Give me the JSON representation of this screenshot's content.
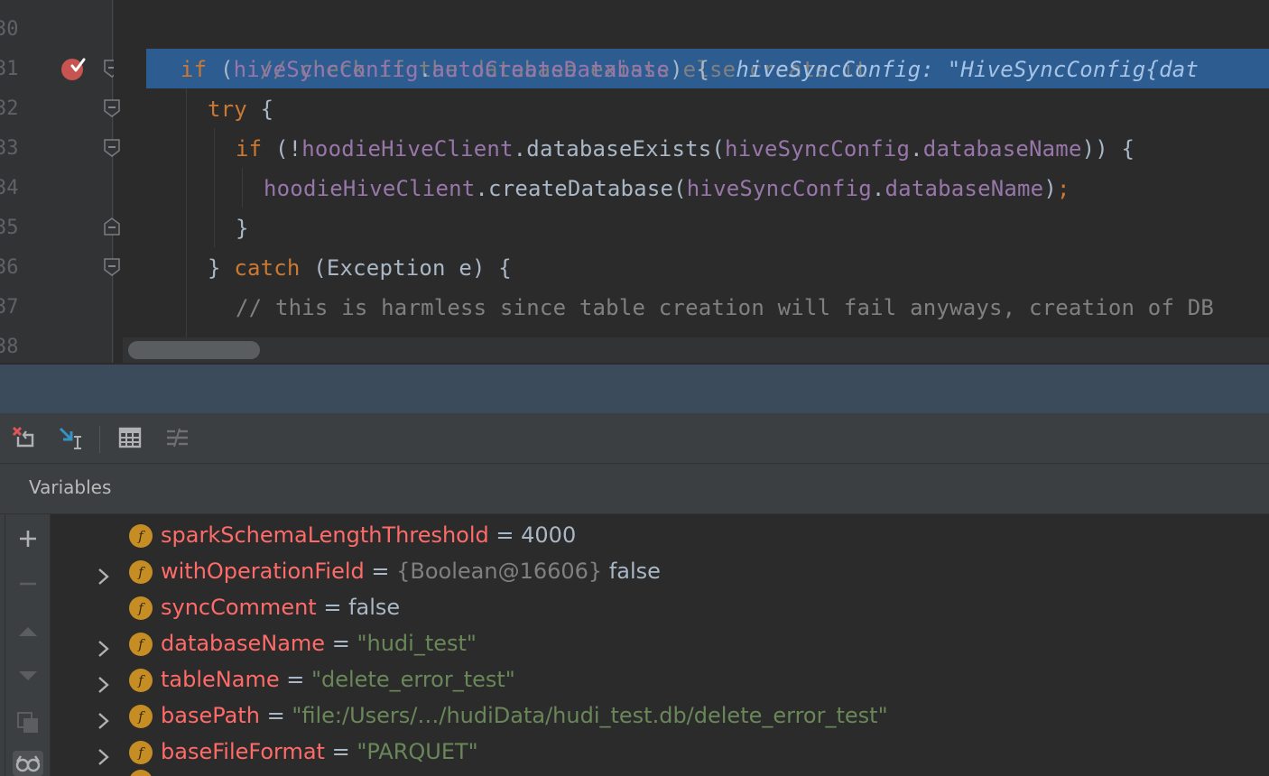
{
  "editor": {
    "line_numbers": [
      "30",
      "31",
      "32",
      "33",
      "34",
      "35",
      "36",
      "37",
      "38"
    ],
    "lines": {
      "l30": {
        "comment": "// check if the database exists else create it"
      },
      "l31": {
        "if": "if",
        "open": " (",
        "obj": "hiveSyncConfig",
        "dot": ".",
        "field": "autoCreateDatabase",
        "close": ") {",
        "inline_hint": "hiveSyncConfig: \"HiveSyncConfig{dat"
      },
      "l32": {
        "try": "try",
        "rest": " {"
      },
      "l33": {
        "if": "if",
        "open": " (!",
        "obj1": "hoodieHiveClient",
        "method": ".databaseExists(",
        "obj2": "hiveSyncConfig",
        "dot": ".",
        "field": "databaseName",
        "close": ")) {"
      },
      "l34": {
        "obj1": "hoodieHiveClient",
        "method": ".createDatabase(",
        "obj2": "hiveSyncConfig",
        "dot": ".",
        "field": "databaseName",
        "close": ")",
        "semi": ";"
      },
      "l35": {
        "brace": "}"
      },
      "l36": {
        "open": "} ",
        "catch": "catch",
        "rest": " (Exception e) {"
      },
      "l37": {
        "comment": "// this is harmless since table creation will fail anyways, creation of DB"
      }
    }
  },
  "debugger": {
    "panel_title": "Variables",
    "toolbar_icons": [
      "restore-layout-icon",
      "show-execution-point-icon",
      "evaluate-table-icon",
      "settings-lines-icon"
    ],
    "side_icons": [
      "add-icon",
      "remove-icon",
      "up-icon",
      "down-icon",
      "copy-icon",
      "watches-icon"
    ],
    "variables": [
      {
        "name": "sparkSchemaLengthThreshold",
        "eq": " = ",
        "ref": "",
        "value": "4000",
        "type": "plain",
        "expandable": false
      },
      {
        "name": "withOperationField",
        "eq": " = ",
        "ref": "{Boolean@16606} ",
        "value": "false",
        "type": "plain",
        "expandable": true
      },
      {
        "name": "syncComment",
        "eq": " = ",
        "ref": "",
        "value": "false",
        "type": "plain",
        "expandable": false
      },
      {
        "name": "databaseName",
        "eq": " = ",
        "ref": "",
        "value": "\"hudi_test\"",
        "type": "string",
        "expandable": true
      },
      {
        "name": "tableName",
        "eq": " = ",
        "ref": "",
        "value": "\"delete_error_test\"",
        "type": "string",
        "expandable": true
      },
      {
        "name": "basePath",
        "eq": " = ",
        "ref": "",
        "value": "\"file:/Users/…/hudiData/hudi_test.db/delete_error_test\"",
        "type": "string",
        "expandable": true
      },
      {
        "name": "baseFileFormat",
        "eq": " = ",
        "ref": "",
        "value": "\"PARQUET\"",
        "type": "string",
        "expandable": true
      }
    ],
    "badge_letter": "f"
  },
  "colors": {
    "execution_line": "#2d5c91",
    "keyword": "#cc7832",
    "field": "#9876aa",
    "comment": "#808080",
    "variable_name": "#ff6b68",
    "string": "#6a8759",
    "badge": "#c58d24"
  }
}
